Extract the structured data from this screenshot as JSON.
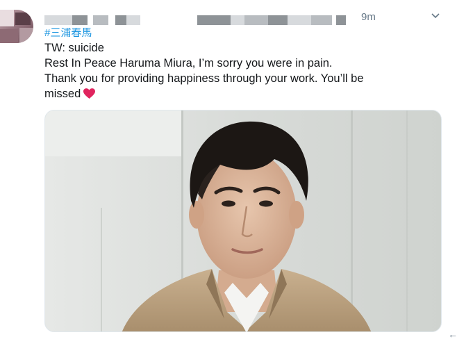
{
  "tweet": {
    "hashtag": "#三浦春馬",
    "timestamp": "9m",
    "lines": [
      "TW: suicide",
      "Rest In Peace Haruma Miura, I’m sorry you were in pain.",
      "Thank you for providing happiness through your work. You’ll be",
      "missed"
    ],
    "emoji": "red-heart-icon",
    "media_kind": "photo",
    "menu_icon": "chevron-down-icon",
    "reply_icon": "reply-arrow-icon",
    "reply_glyph": "←"
  },
  "colors": {
    "link": "#1b95e0",
    "muted": "#657786",
    "heart": "#e0245e",
    "text": "#14171a"
  }
}
